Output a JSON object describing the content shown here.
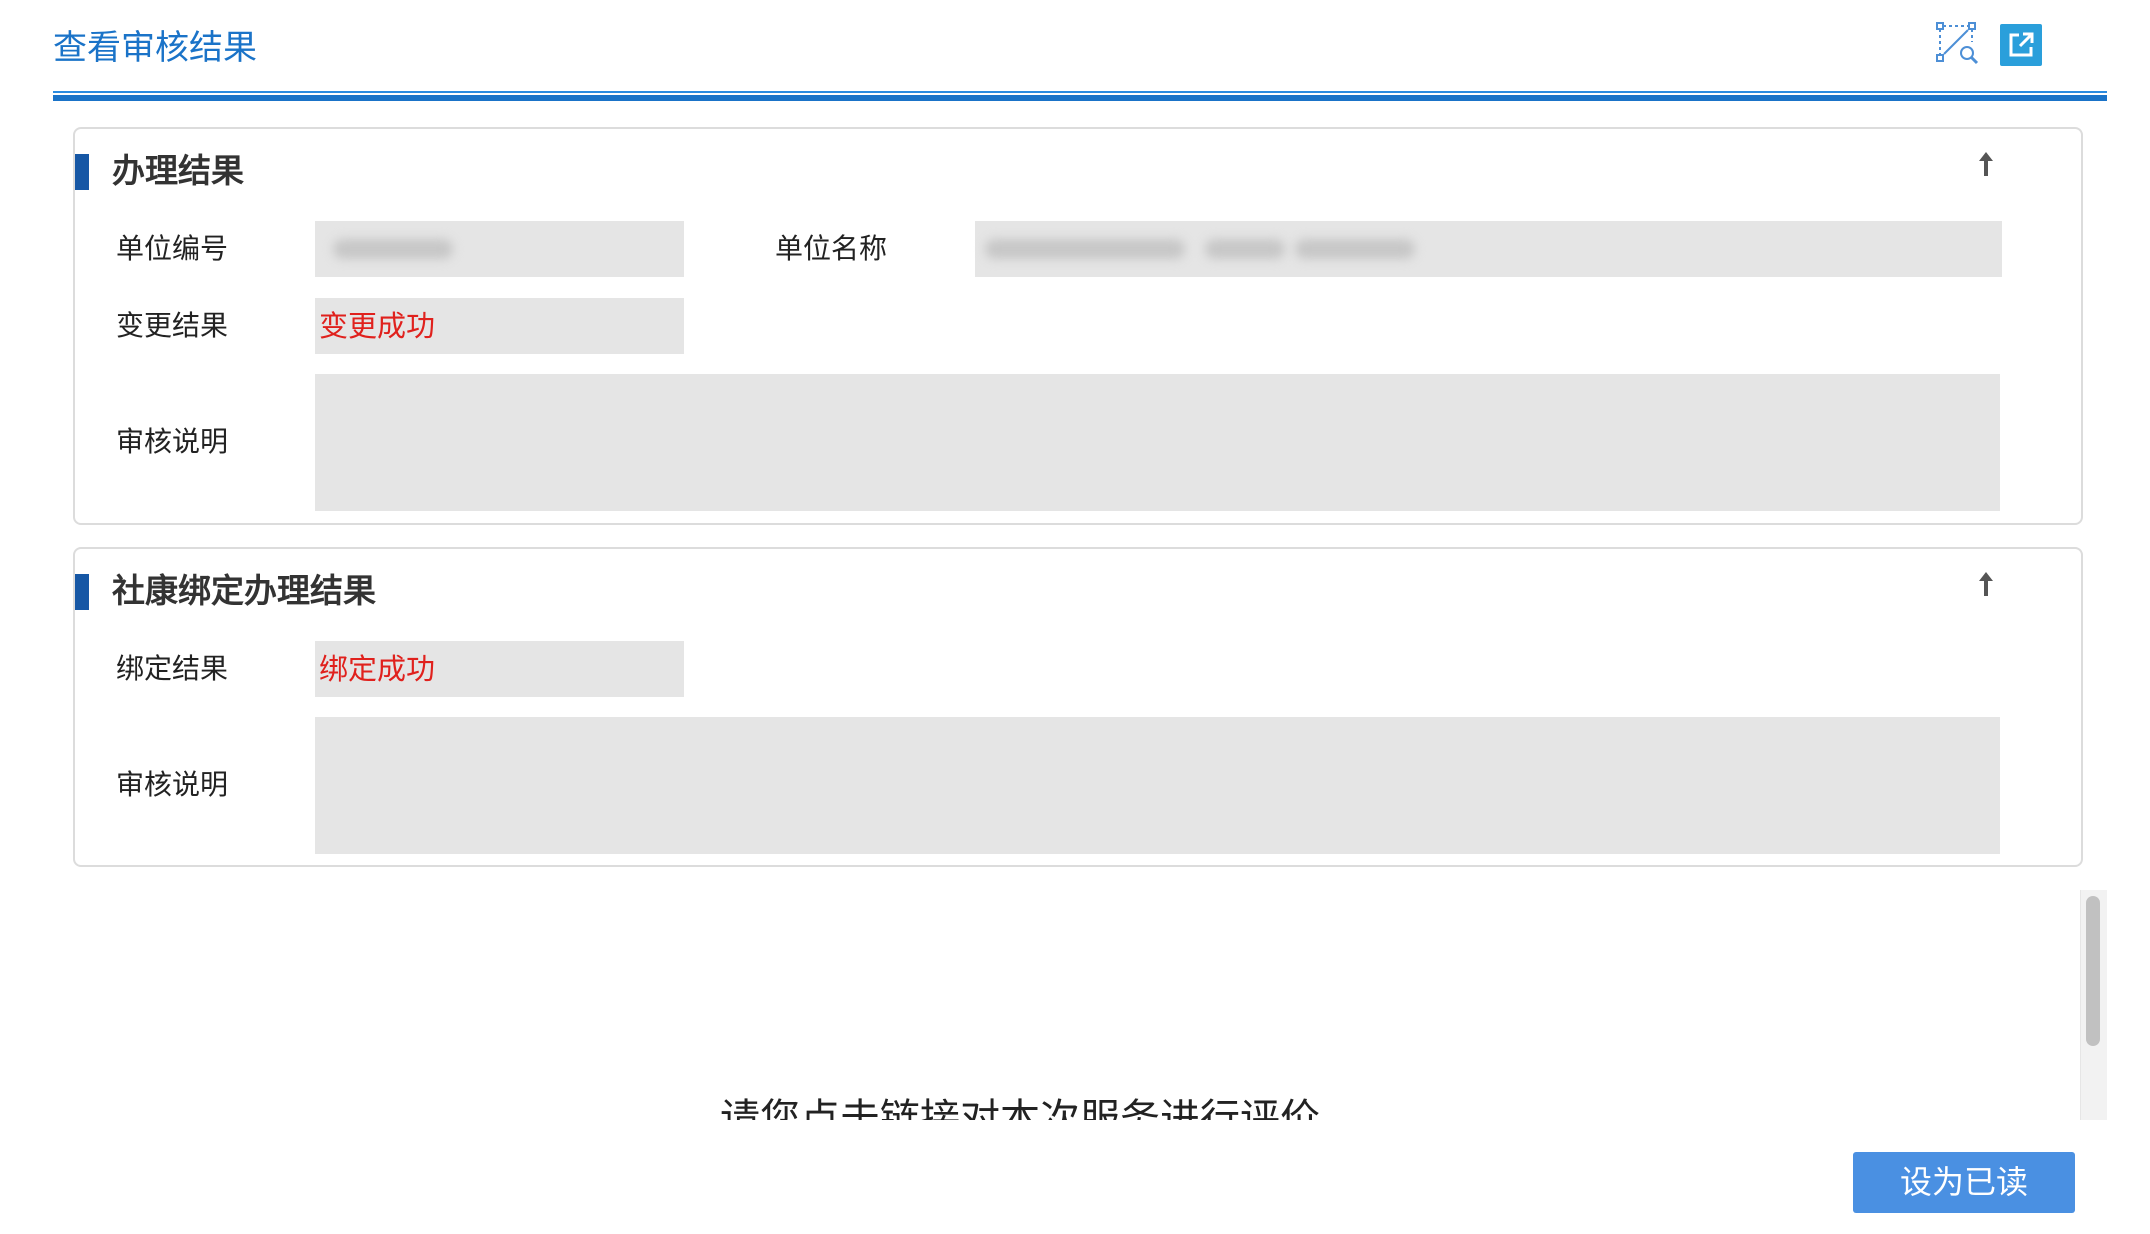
{
  "dialog": {
    "title": "查看审核结果",
    "icons": {
      "fit": "fit-window-icon",
      "popout": "open-external-icon"
    }
  },
  "sections": {
    "result": {
      "title": "办理结果",
      "unit_code_label": "单位编号",
      "unit_name_label": "单位名称",
      "change_result_label": "变更结果",
      "change_result_value": "变更成功",
      "review_note_label": "审核说明"
    },
    "binding": {
      "title": "社康绑定办理结果",
      "bind_result_label": "绑定结果",
      "bind_result_value": "绑定成功",
      "review_note_label": "审核说明"
    }
  },
  "evaluation_prompt": "请您点击链接对本次服务进行评价",
  "footer": {
    "mark_read_label": "设为已读"
  },
  "colors": {
    "accent": "#1a73c8",
    "success_text": "#e0211d",
    "button": "#4a90e2",
    "marker": "#1657a5"
  }
}
